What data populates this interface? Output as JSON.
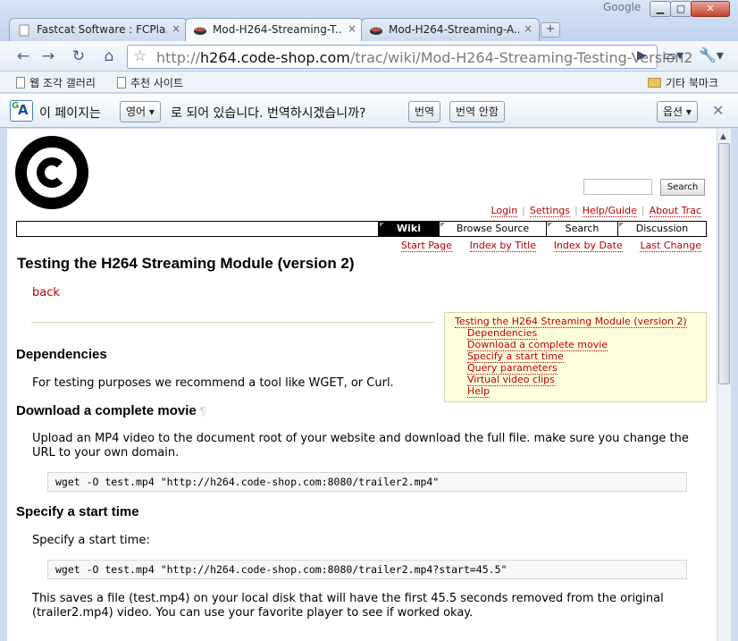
{
  "window": {
    "brand": "Google",
    "tabs": [
      {
        "title": "Fastcat Software : FCPla...",
        "close": "×"
      },
      {
        "title": "Mod-H264-Streaming-T...",
        "close": "×"
      },
      {
        "title": "Mod-H264-Streaming-A...",
        "close": "×"
      }
    ],
    "new_tab": "+"
  },
  "toolbar": {
    "back": "←",
    "forward": "→",
    "reload": "↻",
    "home": "⌂",
    "url_prefix": "http://",
    "url_host": "h264.code-shop.com",
    "url_path": "/trac/wiki/Mod-H264-Streaming-Testing-Version2",
    "go": "▶",
    "page_menu": "▭▾",
    "tools_menu": "🔧▾"
  },
  "bookmarks": {
    "items": [
      {
        "label": "웹 조각 갤러리"
      },
      {
        "label": "추천 사이트"
      }
    ],
    "other": "기타 북마크"
  },
  "infobar": {
    "text_before": "이 페이지는",
    "language": "영어 ▾",
    "text_after": "로 되어 있습니다. 번역하시겠습니까?",
    "translate_btn": "번역",
    "no_translate_btn": "번역 안함",
    "options_btn": "옵션 ▾",
    "close": "✕"
  },
  "trac": {
    "search_button": "Search",
    "metanav": [
      "Login",
      "Settings",
      "Help/Guide",
      "About Trac"
    ],
    "mainnav": [
      "Wiki",
      "Browse Source",
      "Search",
      "Discussion"
    ],
    "ctxtnav": [
      "Start Page",
      "Index by Title",
      "Index by Date",
      "Last Change"
    ],
    "title": "Testing the H264 Streaming Module (version 2)",
    "back": "back",
    "toc": [
      "Testing the H264 Streaming Module (version 2)",
      "Dependencies",
      "Download a complete movie",
      "Specify a start time",
      "Query parameters",
      "Virtual video clips",
      "Help"
    ],
    "sections": {
      "dependencies": {
        "heading": "Dependencies",
        "text": "For testing purposes we recommend a tool like WGET, or Curl."
      },
      "download": {
        "heading": "Download a complete movie",
        "pilcrow": "¶",
        "text": "Upload an MP4 video to the document root of your website and download the full file. make sure you change the URL to your own domain.",
        "code": "wget -O test.mp4 \"http://h264.code-shop.com:8080/trailer2.mp4\""
      },
      "start_time": {
        "heading": "Specify a start time",
        "text": "Specify a start time:",
        "code": "wget -O test.mp4 \"http://h264.code-shop.com:8080/trailer2.mp4?start=45.5\"",
        "text2": "This saves a file (test.mp4) on your local disk that will have the first 45.5 seconds removed from the original (trailer2.mp4) video. You can use your favorite player to see if worked okay."
      }
    }
  }
}
